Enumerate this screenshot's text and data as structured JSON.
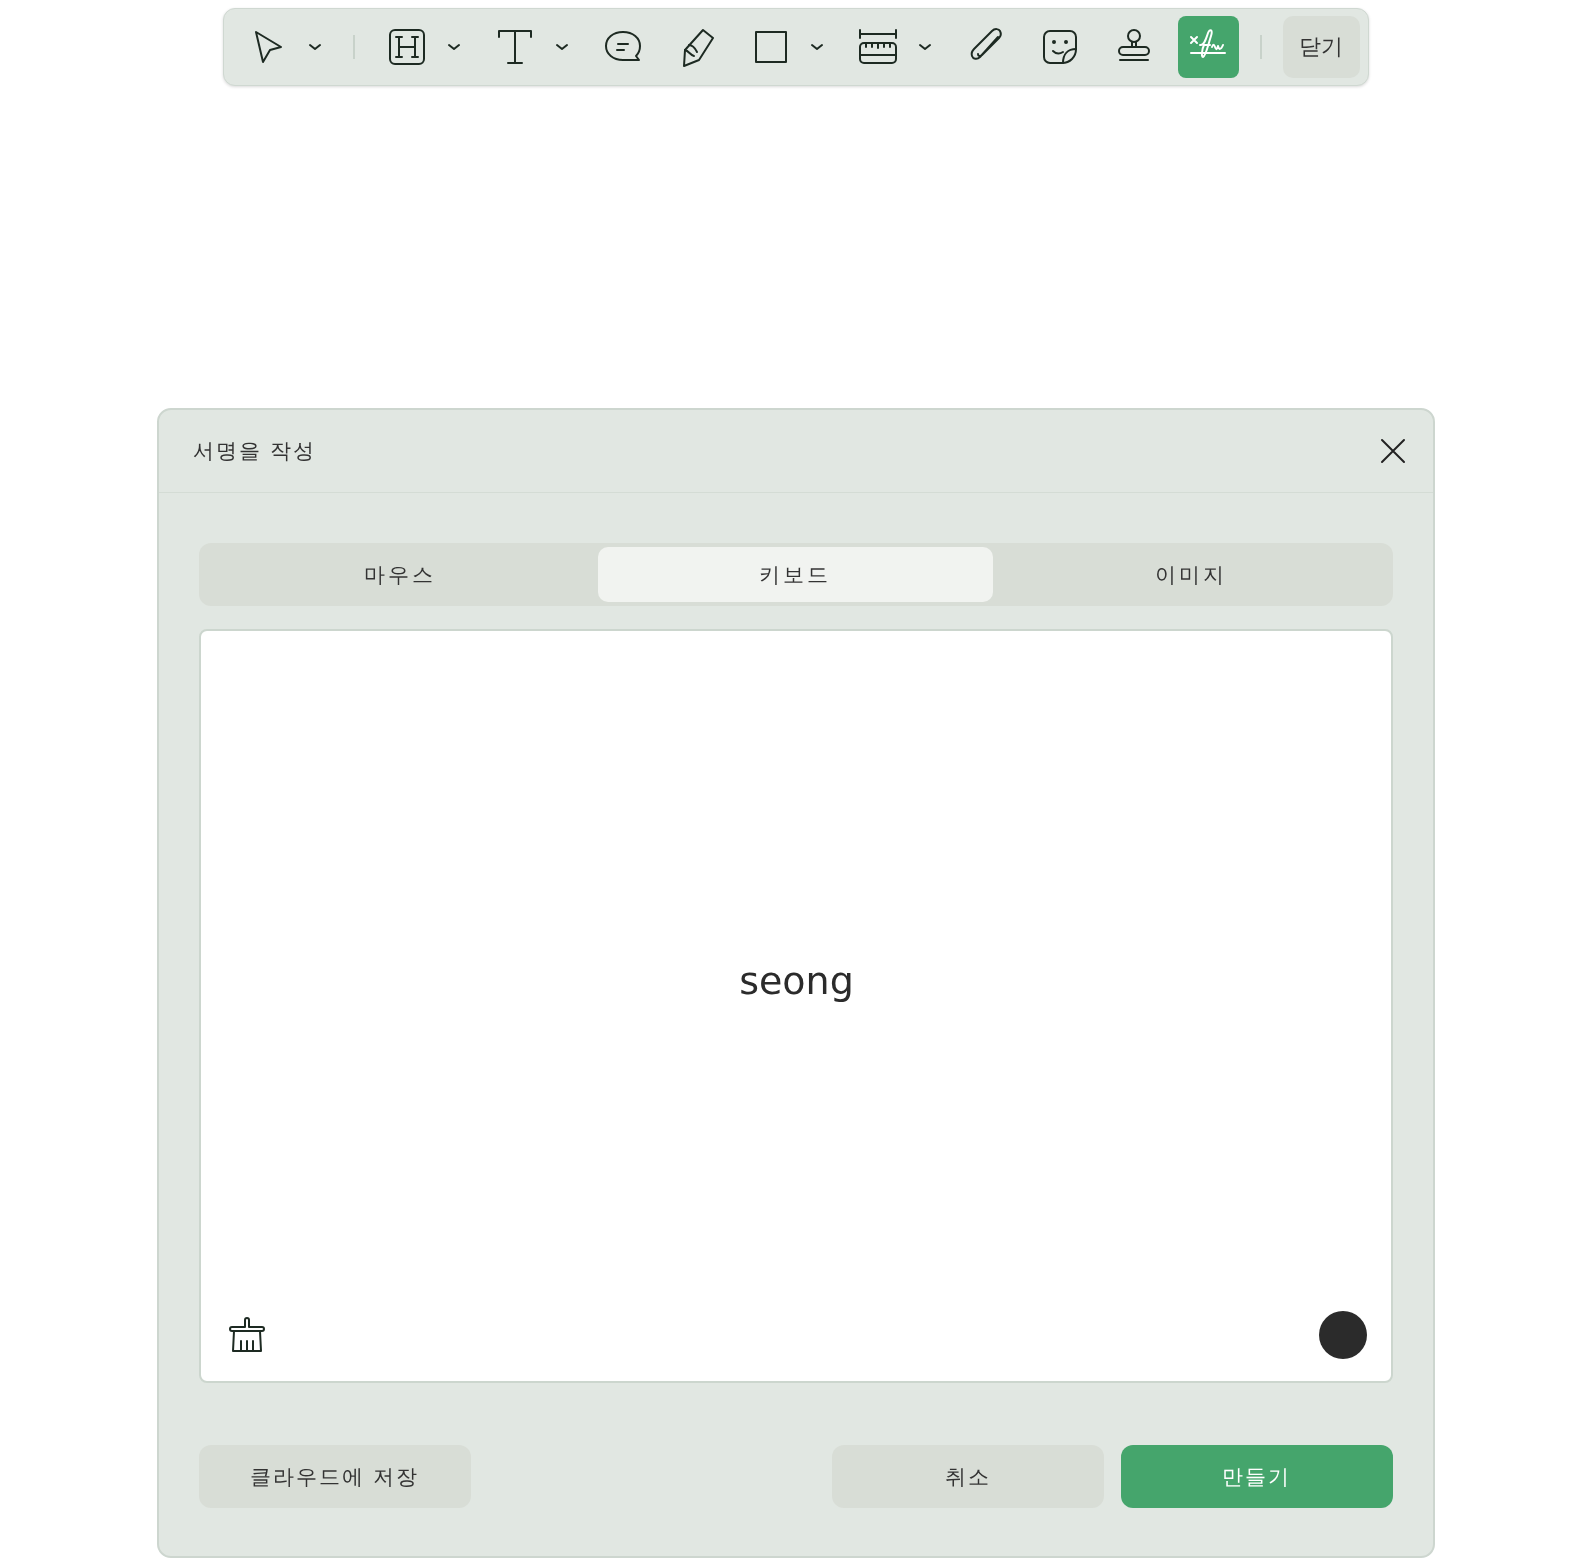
{
  "toolbar": {
    "tools": [
      {
        "kind": "select",
        "dropdown": true,
        "selected": false,
        "divider_after": true
      },
      {
        "kind": "heading",
        "dropdown": true,
        "selected": false
      },
      {
        "kind": "text",
        "dropdown": true,
        "selected": false
      },
      {
        "kind": "comment",
        "dropdown": false,
        "selected": false
      },
      {
        "kind": "pen",
        "dropdown": false,
        "selected": false
      },
      {
        "kind": "rectangle",
        "dropdown": true,
        "selected": false
      },
      {
        "kind": "measure",
        "dropdown": true,
        "selected": false
      },
      {
        "kind": "attach",
        "dropdown": false,
        "selected": false
      },
      {
        "kind": "sticker",
        "dropdown": false,
        "selected": false
      },
      {
        "kind": "stamp",
        "dropdown": false,
        "selected": false
      },
      {
        "kind": "signature",
        "dropdown": false,
        "selected": true
      }
    ],
    "close_label": "닫기"
  },
  "dialog": {
    "title": "서명을 작성",
    "tabs": [
      {
        "label": "마우스",
        "selected": false
      },
      {
        "label": "키보드",
        "selected": true
      },
      {
        "label": "이미지",
        "selected": false
      }
    ],
    "signature_text": "seong",
    "ink": {
      "color": "#2b2b2b"
    },
    "buttons": [
      {
        "label": "클라우드에 저장",
        "kind": "secondary"
      },
      {
        "label": "취소",
        "kind": "secondary"
      },
      {
        "label": "만들기",
        "kind": "primary"
      }
    ]
  }
}
